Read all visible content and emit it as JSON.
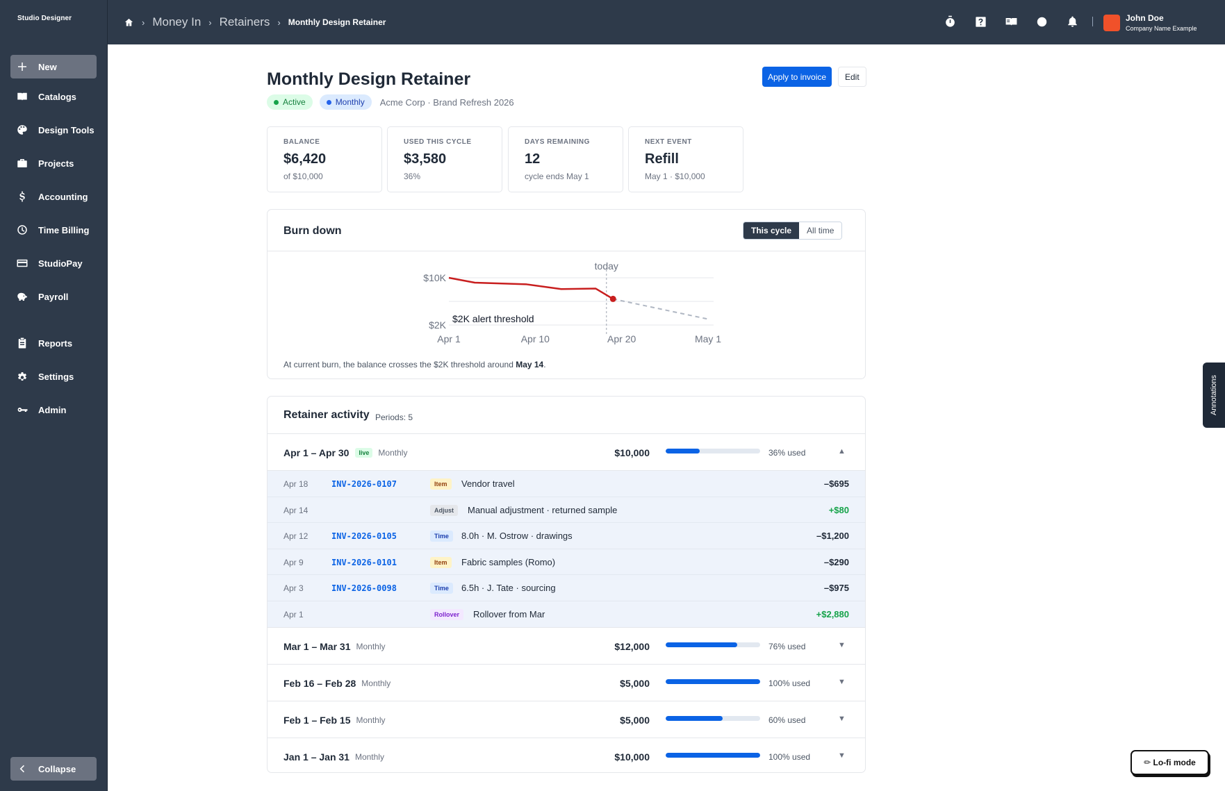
{
  "app": {
    "brand": "Studio Designer"
  },
  "sidebar": {
    "new_label": "New",
    "items": [
      {
        "label": "Catalogs",
        "icon": "book-icon"
      },
      {
        "label": "Design Tools",
        "icon": "palette-icon"
      },
      {
        "label": "Projects",
        "icon": "briefcase-icon"
      },
      {
        "label": "Accounting",
        "icon": "dollar-icon"
      },
      {
        "label": "Time Billing",
        "icon": "clock-icon"
      },
      {
        "label": "StudioPay",
        "icon": "card-icon"
      },
      {
        "label": "Payroll",
        "icon": "piggy-bank-icon"
      },
      {
        "label": "Reports",
        "icon": "clipboard-icon"
      },
      {
        "label": "Settings",
        "icon": "gear-icon"
      },
      {
        "label": "Admin",
        "icon": "key-icon"
      }
    ],
    "collapse_label": "Collapse"
  },
  "topbar": {
    "breadcrumbs": [
      "Money In",
      "Retainers",
      "Monthly Design Retainer"
    ],
    "icons": [
      "stopwatch-icon",
      "help-icon",
      "book-open-icon",
      "circle-icon",
      "bell-icon"
    ],
    "user": {
      "name": "John Doe",
      "company": "Company Name Example"
    }
  },
  "page": {
    "title": "Monthly Design Retainer",
    "status": "Active",
    "frequency": "Monthly",
    "client": "Acme Corp · Brand Refresh 2026",
    "apply_label": "Apply to invoice",
    "edit_label": "Edit"
  },
  "stats": [
    {
      "label": "BALANCE",
      "value": "$6,420",
      "sub": "of $10,000"
    },
    {
      "label": "USED THIS CYCLE",
      "value": "$3,580",
      "sub": "36%"
    },
    {
      "label": "DAYS REMAINING",
      "value": "12",
      "sub": "cycle ends May 1"
    },
    {
      "label": "NEXT EVENT",
      "value": "Refill",
      "sub": "May 1 · $10,000"
    }
  ],
  "burndown": {
    "title": "Burn down",
    "toggle": [
      "This cycle",
      "All time"
    ],
    "note_prefix": "At current burn, the balance crosses the $2K threshold around ",
    "note_date": "May 14",
    "note_suffix": "."
  },
  "chart_data": {
    "type": "line",
    "title": "Burn down",
    "x_ticks": [
      "Apr 1",
      "Apr 10",
      "Apr 20",
      "May 1"
    ],
    "y_ticks": [
      "$10K",
      "$2K"
    ],
    "ylim": [
      2000,
      10000
    ],
    "xlim": [
      1,
      31
    ],
    "series": [
      {
        "x": [
          1,
          4,
          10,
          14,
          18,
          20
        ],
        "y": [
          10000,
          9180,
          8890,
          8090,
          8170,
          6420
        ],
        "style": "solid",
        "color": "#c81e1e"
      },
      {
        "x": [
          20,
          31
        ],
        "y": [
          6420,
          3000
        ],
        "style": "dashed",
        "color": "#b0b7c3"
      }
    ],
    "today_label": "today",
    "today_x": 19,
    "threshold": 2000,
    "threshold_label": "$2K alert threshold",
    "grid": true
  },
  "activity": {
    "title": "Retainer activity",
    "periods_count": "Periods: 5",
    "current_period": {
      "range": "Apr 1 – Apr 30",
      "live": "live",
      "freq": "Monthly",
      "amount": "$10,000",
      "used_pct": 36,
      "used_label": "36% used",
      "chevron": "▲"
    },
    "entries": [
      {
        "date": "Apr 18",
        "invoice": "INV-2026-0107",
        "tag": "Item",
        "tag_class": "item",
        "desc": "Vendor travel",
        "amount": "–$695",
        "positive": false
      },
      {
        "date": "Apr 14",
        "invoice": "",
        "tag": "Adjust",
        "tag_class": "adjust",
        "desc": "Manual adjustment · returned sample",
        "amount": "+$80",
        "positive": true
      },
      {
        "date": "Apr 12",
        "invoice": "INV-2026-0105",
        "tag": "Time",
        "tag_class": "time",
        "desc": "8.0h · M. Ostrow · drawings",
        "amount": "–$1,200",
        "positive": false
      },
      {
        "date": "Apr 9",
        "invoice": "INV-2026-0101",
        "tag": "Item",
        "tag_class": "item",
        "desc": "Fabric samples (Romo)",
        "amount": "–$290",
        "positive": false
      },
      {
        "date": "Apr 3",
        "invoice": "INV-2026-0098",
        "tag": "Time",
        "tag_class": "time",
        "desc": "6.5h · J. Tate · sourcing",
        "amount": "–$975",
        "positive": false
      },
      {
        "date": "Apr 1",
        "invoice": "",
        "tag": "Rollover",
        "tag_class": "rollover",
        "desc": "Rollover from Mar",
        "amount": "+$2,880",
        "positive": true
      }
    ],
    "past_periods": [
      {
        "range": "Mar 1 – Mar 31",
        "freq": "Monthly",
        "amount": "$12,000",
        "used_pct": 76,
        "used_label": "76% used",
        "chevron": "▼"
      },
      {
        "range": "Feb 16 – Feb 28",
        "freq": "Monthly",
        "amount": "$5,000",
        "used_pct": 100,
        "used_label": "100% used",
        "chevron": "▼"
      },
      {
        "range": "Feb 1 – Feb 15",
        "freq": "Monthly",
        "amount": "$5,000",
        "used_pct": 60,
        "used_label": "60% used",
        "chevron": "▼"
      },
      {
        "range": "Jan 1 – Jan 31",
        "freq": "Monthly",
        "amount": "$10,000",
        "used_pct": 100,
        "used_label": "100% used",
        "chevron": "▼"
      }
    ]
  },
  "floating": {
    "annotations": "Annotations",
    "lofi": "✏ Lo-fi mode"
  },
  "colors": {
    "brand_blue": "#0b63e5",
    "sidebar": "#2e3a4a",
    "burn_red": "#c81e1e",
    "avatar": "#f0512a"
  }
}
